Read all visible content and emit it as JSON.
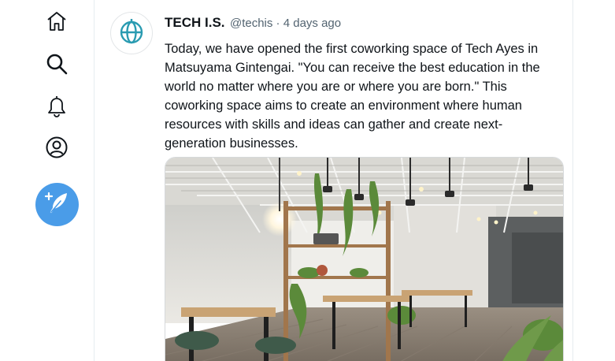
{
  "sidebar": {
    "items": [
      {
        "icon": "home-icon"
      },
      {
        "icon": "search-icon"
      },
      {
        "icon": "bell-icon"
      },
      {
        "icon": "profile-icon"
      }
    ],
    "compose_icon": "feather-plus-icon",
    "accent_color": "#4a9ce8"
  },
  "tweet": {
    "author_name": "TECH I.S.",
    "author_meta": "@techis · 4 days ago",
    "text": "Today, we have opened the first coworking space of Tech Ayes in Matsuyama Gintengai. \"You can receive the best education in the world no matter where you are or where you are born.\" This coworking space aims to create an environment where human resources with skills and ideas can gather and create next-generation businesses.",
    "avatar_icon": "globe-icon",
    "avatar_color": "#2a9bb1",
    "image": "coworking-space-photo"
  }
}
